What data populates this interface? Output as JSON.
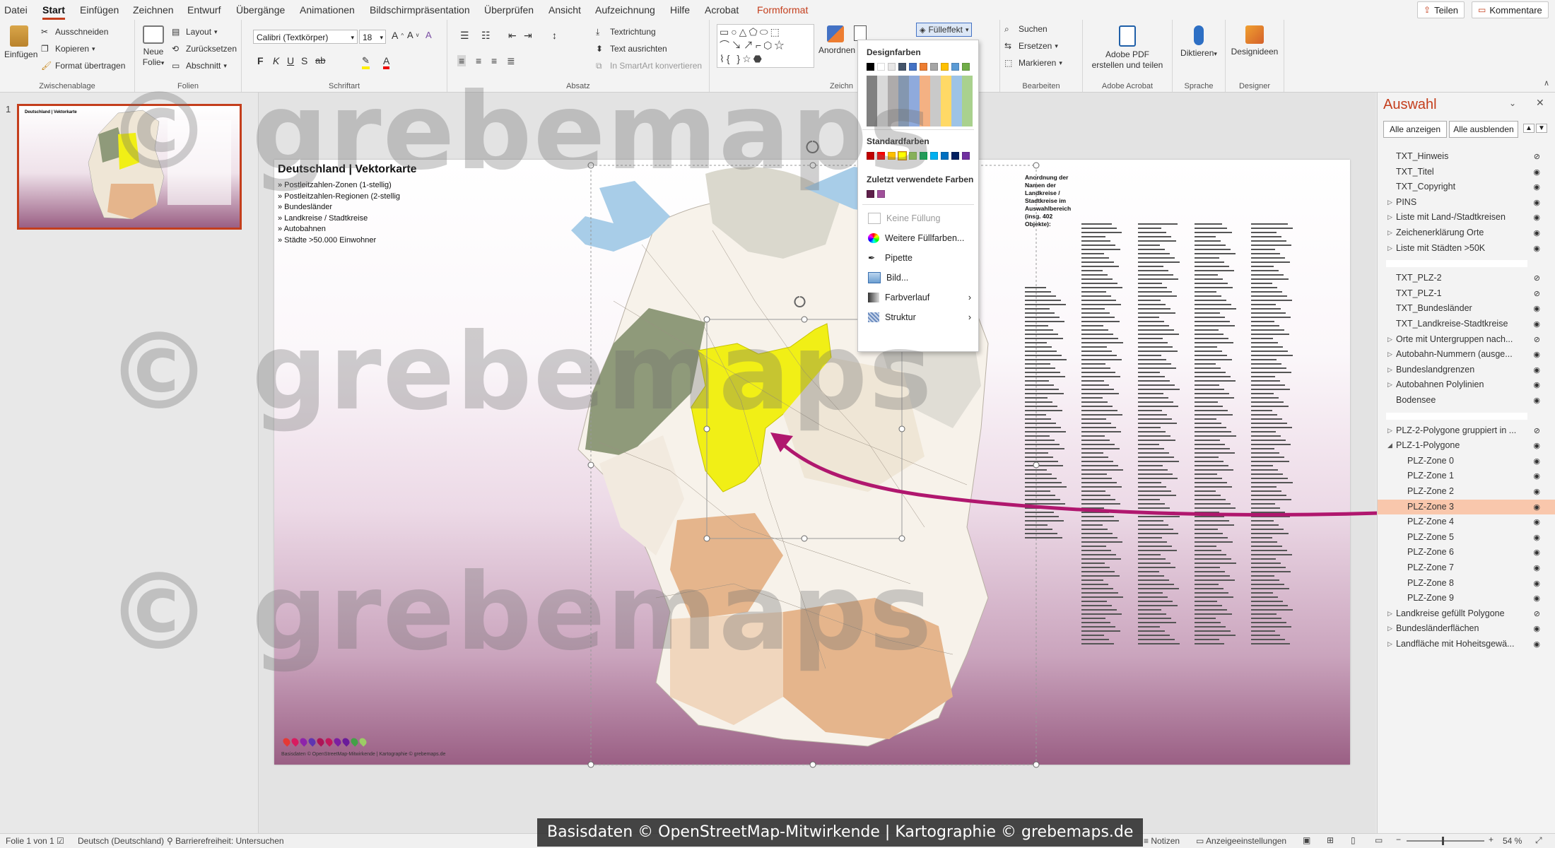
{
  "menubar": {
    "tabs": [
      "Datei",
      "Start",
      "Einfügen",
      "Zeichnen",
      "Entwurf",
      "Übergänge",
      "Animationen",
      "Bildschirmpräsentation",
      "Überprüfen",
      "Ansicht",
      "Aufzeichnung",
      "Hilfe",
      "Acrobat",
      "Formformat"
    ],
    "active_tab": "Start",
    "share_label": "Teilen",
    "comments_label": "Kommentare"
  },
  "ribbon": {
    "clipboard": {
      "paste": "Einfügen",
      "cut": "Ausschneiden",
      "copy": "Kopieren",
      "format_painter": "Format übertragen",
      "label": "Zwischenablage"
    },
    "slides": {
      "new_slide_1": "Neue",
      "new_slide_2": "Folie",
      "layout": "Layout",
      "reset": "Zurücksetzen",
      "section": "Abschnitt",
      "label": "Folien"
    },
    "font": {
      "family": "Calibri (Textkörper)",
      "size": "18",
      "bold": "F",
      "italic": "K",
      "underline": "U",
      "strike": "S",
      "shadow": "ab",
      "label": "Schriftart"
    },
    "paragraph": {
      "text_direction": "Textrichtung",
      "align_text": "Text ausrichten",
      "smartart": "In SmartArt konvertieren",
      "label": "Absatz"
    },
    "drawing": {
      "arrange": "Anordnen",
      "label": "Zeichn",
      "fill_effect": "Fülleffekt"
    },
    "editing": {
      "find": "Suchen",
      "replace": "Ersetzen",
      "select": "Markieren",
      "label": "Bearbeiten"
    },
    "acrobat": {
      "create_pdf_1": "Adobe PDF",
      "create_pdf_2": "erstellen und teilen",
      "label": "Adobe Acrobat"
    },
    "voice": {
      "dictate": "Diktieren",
      "label": "Sprache"
    },
    "designer": {
      "ideas": "Designideen",
      "label": "Designer"
    }
  },
  "fill_menu": {
    "theme_colors": "Designfarben",
    "standard_colors": "Standardfarben",
    "recent_colors": "Zuletzt verwendete Farben",
    "no_fill": "Keine Füllung",
    "more_colors": "Weitere Füllfarben...",
    "eyedropper": "Pipette",
    "picture": "Bild...",
    "gradient": "Farbverlauf",
    "texture": "Struktur",
    "theme_row": [
      "#000000",
      "#ffffff",
      "#e7e6e6",
      "#44546a",
      "#4472c4",
      "#ed7d31",
      "#a5a5a5",
      "#ffc000",
      "#5b9bd5",
      "#70ad47"
    ],
    "standard_row": [
      "#c00000",
      "#ff0000",
      "#ffc000",
      "#ffff00",
      "#92d050",
      "#00b050",
      "#00b0f0",
      "#0070c0",
      "#002060",
      "#7030a0"
    ],
    "recent_row": [
      "#5e1f4a",
      "#a0509a"
    ]
  },
  "thumbnails": {
    "slide_number": "1"
  },
  "slide": {
    "title": "Deutschland | Vektorkarte",
    "bullets": [
      "» Postleitzahlen-Zonen (1-stellig)",
      "» Postleitzahlen-Regionen (2-stellig",
      "» Bundesländer",
      "» Landkreise / Stadtkreise",
      "» Autobahnen",
      "» Städte >50.000 Einwohner"
    ],
    "legend_heading": "Anordnung der Namen der Landkreise / Stadtkreise im Auswahlbereich (insg. 402 Objekte):",
    "footer_small": "Basisdaten © OpenStreetMap-Mitwirkende | Kartographie © grebemaps.de",
    "pin_colors": [
      "#e53935",
      "#d81b60",
      "#8e24aa",
      "#5e35b1",
      "#ad1457",
      "#c2185b",
      "#7b1fa2",
      "#6a1b9a",
      "#43a047",
      "#9ccc65"
    ],
    "map_colors": {
      "highlight": "#f1ef16",
      "olive": "#8f9a7a",
      "beige": "#f2eadf",
      "light": "#f7f2ea",
      "orange": "#e5b58c",
      "salmon": "#eac4a3",
      "grey": "#e0ddd5",
      "water": "#a8cde8"
    }
  },
  "selection_pane": {
    "title": "Auswahl",
    "show_all": "Alle anzeigen",
    "hide_all": "Alle ausblenden",
    "items": [
      {
        "name": "TXT_Hinweis",
        "hidden": true
      },
      {
        "name": "TXT_Titel",
        "hidden": false
      },
      {
        "name": "TXT_Copyright",
        "hidden": false
      },
      {
        "name": "PINS",
        "hidden": false,
        "group": true
      },
      {
        "name": "Liste mit Land-/Stadtkreisen",
        "hidden": false,
        "group": true
      },
      {
        "name": "Zeichenerklärung Orte",
        "hidden": false,
        "group": true
      },
      {
        "name": "Liste mit Städten >50K",
        "hidden": false,
        "group": true
      },
      {
        "name": "",
        "hidden": false,
        "divider": true
      },
      {
        "name": "TXT_PLZ-2",
        "hidden": true
      },
      {
        "name": "TXT_PLZ-1",
        "hidden": true
      },
      {
        "name": "TXT_Bundesländer",
        "hidden": false
      },
      {
        "name": "TXT_Landkreise-Stadtkreise",
        "hidden": false
      },
      {
        "name": "Orte mit Untergruppen nach...",
        "hidden": true,
        "group": true
      },
      {
        "name": "Autobahn-Nummern (ausge...",
        "hidden": false,
        "group": true
      },
      {
        "name": "Bundeslandgrenzen",
        "hidden": false,
        "group": true
      },
      {
        "name": "Autobahnen Polylinien",
        "hidden": false,
        "group": true
      },
      {
        "name": "Bodensee",
        "hidden": false
      },
      {
        "name": "",
        "hidden": false,
        "divider": true
      },
      {
        "name": "PLZ-2-Polygone gruppiert in ...",
        "hidden": true,
        "group": true
      },
      {
        "name": "PLZ-1-Polygone",
        "hidden": false,
        "group": true,
        "expanded": true
      },
      {
        "name": "PLZ-Zone 0",
        "hidden": false,
        "sub": true
      },
      {
        "name": "PLZ-Zone 1",
        "hidden": false,
        "sub": true
      },
      {
        "name": "PLZ-Zone 2",
        "hidden": false,
        "sub": true
      },
      {
        "name": "PLZ-Zone 3",
        "hidden": false,
        "sub": true,
        "selected": true
      },
      {
        "name": "PLZ-Zone 4",
        "hidden": false,
        "sub": true
      },
      {
        "name": "PLZ-Zone 5",
        "hidden": false,
        "sub": true
      },
      {
        "name": "PLZ-Zone 6",
        "hidden": false,
        "sub": true
      },
      {
        "name": "PLZ-Zone 7",
        "hidden": false,
        "sub": true
      },
      {
        "name": "PLZ-Zone 8",
        "hidden": false,
        "sub": true
      },
      {
        "name": "PLZ-Zone 9",
        "hidden": false,
        "sub": true
      },
      {
        "name": "Landkreise gefüllt Polygone",
        "hidden": true,
        "group": true
      },
      {
        "name": "Bundesländerflächen",
        "hidden": false,
        "group": true
      },
      {
        "name": "Landfläche mit Hoheitsgewä...",
        "hidden": false,
        "group": true
      }
    ]
  },
  "statusbar": {
    "slide_count": "Folie 1 von 1",
    "language": "Deutsch (Deutschland)",
    "accessibility": "Barrierefreiheit: Untersuchen",
    "notes": "Notizen",
    "display_settings": "Anzeigeeinstellungen",
    "zoom": "54 %"
  },
  "watermark": {
    "text": "© grebemaps",
    "credit": "Basisdaten © OpenStreetMap-Mitwirkende | Kartographie © grebemaps.de"
  }
}
